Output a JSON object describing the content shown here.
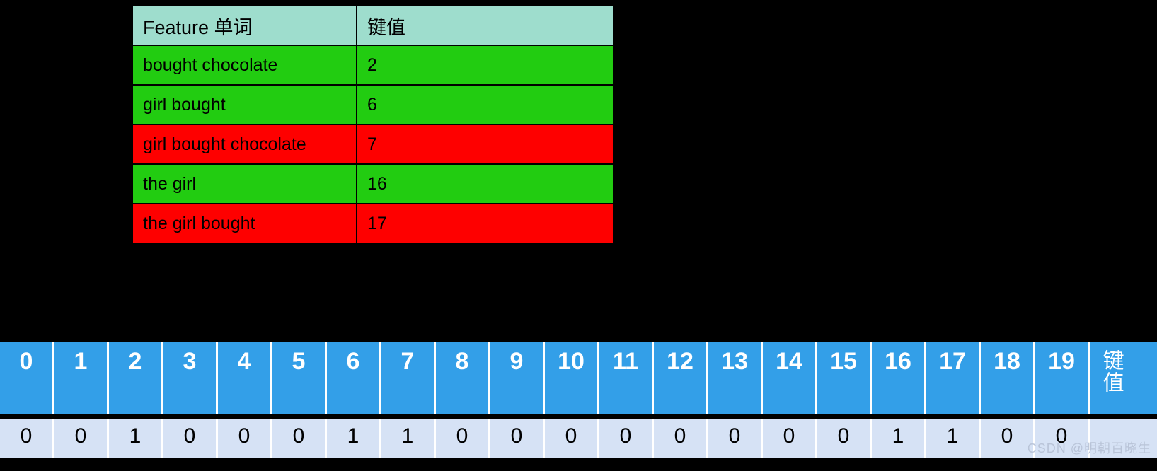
{
  "feature_table": {
    "headers": [
      "Feature 单词",
      "键值"
    ],
    "rows": [
      {
        "feature": "bought chocolate",
        "key": "2",
        "state": "green"
      },
      {
        "feature": "girl bought",
        "key": "6",
        "state": "green"
      },
      {
        "feature": "girl bought chocolate",
        "key": "7",
        "state": "red"
      },
      {
        "feature": "the girl",
        "key": "16",
        "state": "green"
      },
      {
        "feature": "the girl bought",
        "key": "17",
        "state": "red"
      }
    ]
  },
  "bit_array": {
    "key_label": "键值",
    "indices": [
      "0",
      "1",
      "2",
      "3",
      "4",
      "5",
      "6",
      "7",
      "8",
      "9",
      "10",
      "11",
      "12",
      "13",
      "14",
      "15",
      "16",
      "17",
      "18",
      "19"
    ],
    "bits": [
      "0",
      "0",
      "1",
      "0",
      "0",
      "0",
      "1",
      "1",
      "0",
      "0",
      "0",
      "0",
      "0",
      "0",
      "0",
      "0",
      "1",
      "1",
      "0",
      "0"
    ]
  },
  "colors": {
    "background": "#000000",
    "header_teal": "#9EDDCD",
    "green": "#22CC11",
    "red": "#FE0000",
    "index_blue": "#339FE8",
    "value_blue": "#D6E2F5"
  },
  "watermark": "CSDN @明朝百晓生"
}
